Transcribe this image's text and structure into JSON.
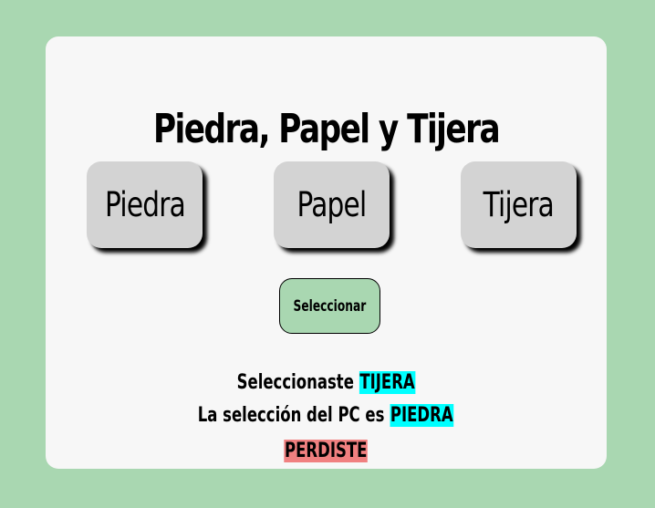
{
  "game": {
    "title": "Piedra, Papel y Tijera",
    "choices": [
      "Piedra",
      "Papel",
      "Tijera"
    ],
    "select_label": "Seleccionar"
  },
  "result": {
    "user_prefix": "Seleccionaste",
    "user_choice": "TIJERA",
    "pc_prefix": "La selección del PC es",
    "pc_choice": "PIEDRA",
    "outcome": "PERDISTE"
  },
  "colors": {
    "page_background": "#a9d7b1",
    "card_background": "#f7f7f7",
    "choice_button": "#d3d3d3",
    "select_button": "#a9d7b1",
    "choice_highlight": "#00ffff",
    "outcome_highlight": "#f08080"
  }
}
